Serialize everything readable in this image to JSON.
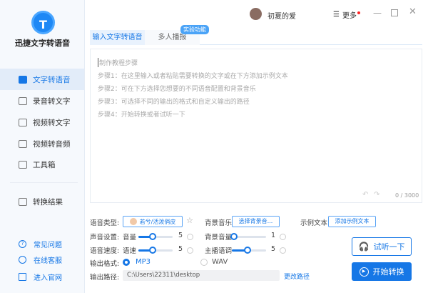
{
  "app": {
    "title": "迅捷文字转语音",
    "logo_letter": "T"
  },
  "sidebar": {
    "items": [
      {
        "label": "文字转语音"
      },
      {
        "label": "录音转文字"
      },
      {
        "label": "视频转文字"
      },
      {
        "label": "视频转音频"
      },
      {
        "label": "工具箱"
      }
    ],
    "result": "转换结果",
    "links": [
      {
        "label": "常见问题"
      },
      {
        "label": "在线客服"
      },
      {
        "label": "进入官网"
      }
    ]
  },
  "header": {
    "username": "初夏的爱",
    "more": "更多"
  },
  "tabs": [
    {
      "label": "输入文字转语音"
    },
    {
      "label": "多人播报"
    }
  ],
  "badge": "实验功能",
  "editor": {
    "lines": [
      "制作教程步骤",
      "步骤1：在这里输入或者粘贴需要转换的文字或在下方添加示例文本",
      "步骤2：可在下方选择您想要的不同语音配置和背景音乐",
      "步骤3：可选择不同的输出的格式和自定义输出的路径",
      "步骤4：开始转换或者试听一下"
    ],
    "counter": "0 / 3000"
  },
  "controls": {
    "voice_type_label": "语音类型:",
    "voice": "若兮/活泼俏皮",
    "bg_music_label": "背景音乐",
    "bg_music_btn": "选择背景音...",
    "sample_label": "示例文本",
    "sample_btn": "添加示例文本",
    "sound_label": "声音设置:",
    "volume_label": "音量",
    "volume": 5,
    "bg_volume_label": "背景音量",
    "bg_volume": 1,
    "speed_label": "语音速度:",
    "speed_sub": "语速",
    "speed": 5,
    "pitch_label": "主播语调",
    "pitch": 5,
    "format_label": "输出格式:",
    "formats": [
      "MP3",
      "WAV"
    ],
    "selected_format": "MP3",
    "path_label": "输出路径:",
    "path": "C:\\Users\\22311\\desktop",
    "change_path": "更改路径",
    "listen": "试听一下",
    "start": "开始转换"
  },
  "colors": {
    "accent": "#1677e6"
  }
}
